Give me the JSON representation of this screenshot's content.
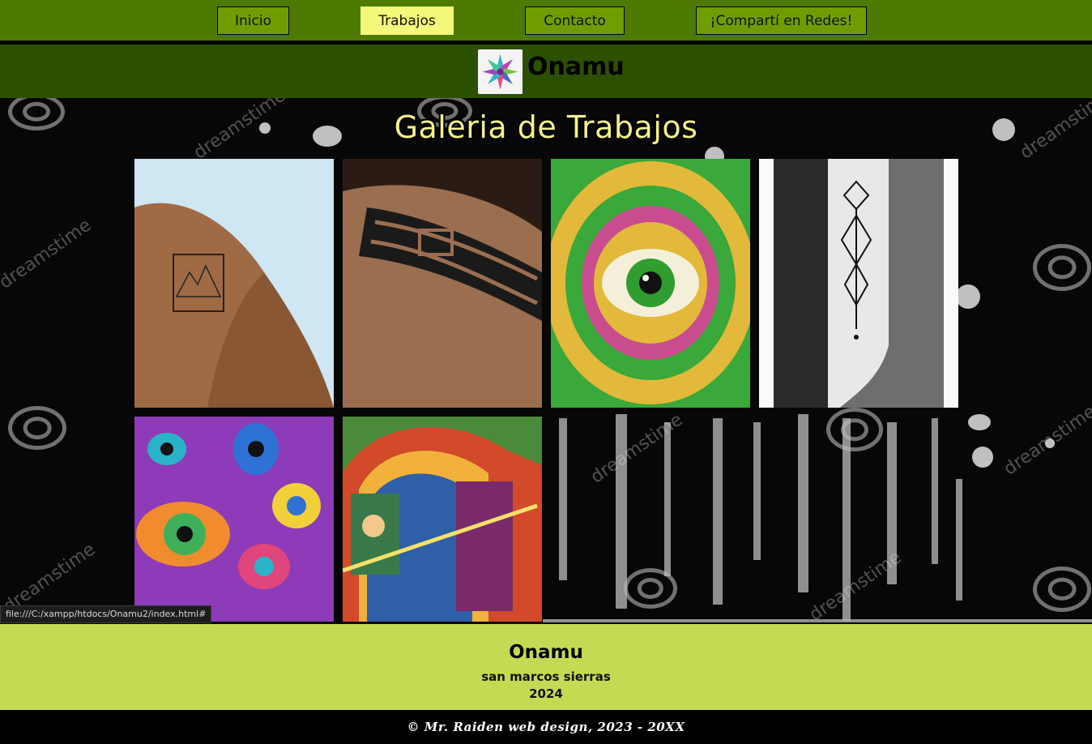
{
  "nav": {
    "items": [
      {
        "label": "Inicio"
      },
      {
        "label": "Trabajos",
        "active": true
      },
      {
        "label": "Contacto"
      },
      {
        "label": "¡Compartí en Redes!"
      }
    ],
    "background": "#4d7a00",
    "active_color": "#f3f77a"
  },
  "brand": {
    "name": "Onamu",
    "logo_icon": "colorful-star-flower-logo",
    "background": "#2b5000"
  },
  "gallery": {
    "title": "Galeria de Trabajos",
    "background_watermark": "dreamstime",
    "images": [
      {
        "name": "shoulder-mountain-tattoo"
      },
      {
        "name": "tribal-armband-tattoo"
      },
      {
        "name": "psychedelic-eye-mandala"
      },
      {
        "name": "geometric-leg-tattoo"
      },
      {
        "name": "colorful-eyes-art"
      },
      {
        "name": "psychedelic-arches-painting"
      }
    ]
  },
  "footer": {
    "name": "Onamu",
    "place": "san marcos sierras",
    "year": "2024",
    "copyright": "© Mr. Raiden web design, 2023 - 20XX",
    "background": "#c4da52"
  },
  "status_bar": {
    "url": "file:///C:/xampp/htdocs/Onamu2/index.html#"
  }
}
